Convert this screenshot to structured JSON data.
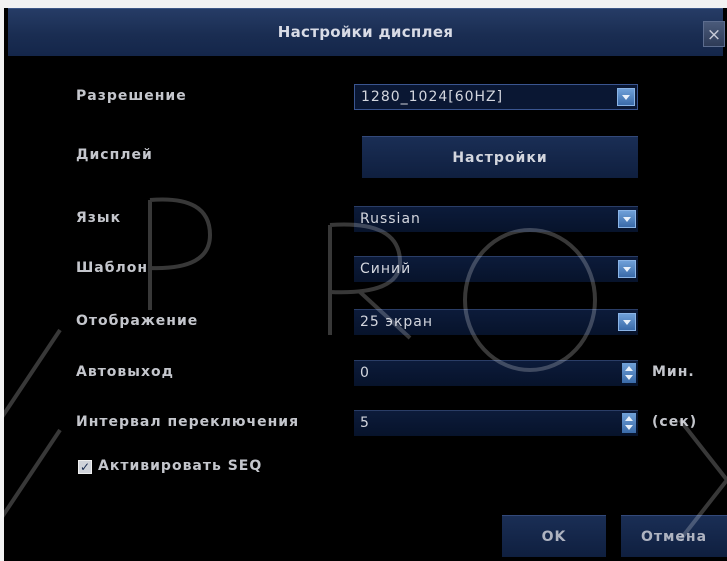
{
  "dialog": {
    "title": "Настройки дисплея",
    "close_glyph": "×",
    "close_icon": "close-icon"
  },
  "rows": {
    "resolution": {
      "label": "Разрешение",
      "value": "1280_1024[60HZ]"
    },
    "display": {
      "label": "Дисплей",
      "button": "Настройки"
    },
    "language": {
      "label": "Язык",
      "value": "Russian"
    },
    "template": {
      "label": "Шаблон",
      "value": "Синий"
    },
    "view": {
      "label": "Отображение",
      "value": "25 экран"
    },
    "autoexit": {
      "label": "Автовыход",
      "value": "0",
      "unit": "Мин."
    },
    "interval": {
      "label": "Интервал переключения",
      "value": "5",
      "unit": "(сек)"
    }
  },
  "seq": {
    "label": "Активировать SEQ",
    "checked": true,
    "check_glyph": "✓"
  },
  "buttons": {
    "ok": "OK",
    "cancel": "Отмена"
  },
  "colors": {
    "background": "#000000",
    "titlebar": "#1a2d52",
    "accent": "#4f86c6",
    "text": "#c4c6cc"
  }
}
